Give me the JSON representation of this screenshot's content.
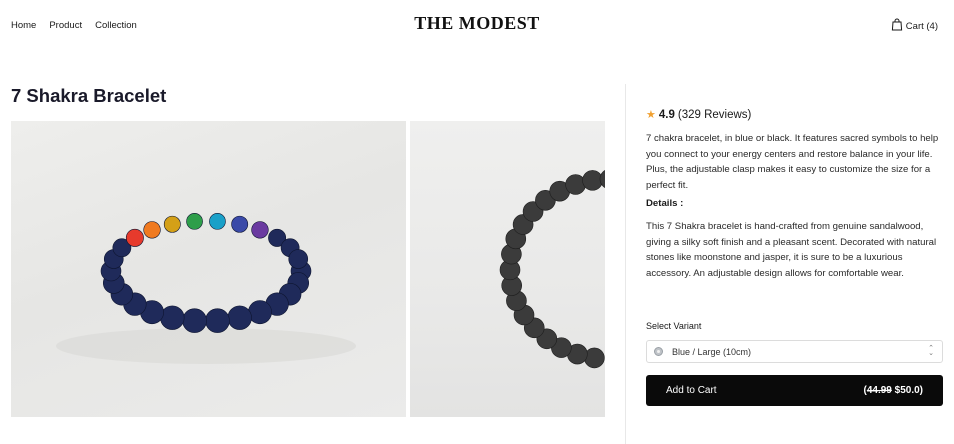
{
  "header": {
    "nav": [
      "Home",
      "Product",
      "Collection"
    ],
    "logo": "THE MODEST",
    "cart_label": "Cart (4)",
    "cart_icon": "shopping-bag-icon"
  },
  "product": {
    "title": "7 Shakra Bracelet",
    "images": [
      "bracelet-colorful-beads-photo",
      "bracelet-lava-stone-photo"
    ],
    "rating": {
      "icon": "star-icon",
      "star_color": "#f0a030",
      "score": "4.9",
      "reviews": "(329 Reviews)"
    },
    "description": "7 chakra bracelet, in blue or black. It features sacred symbols to help you connect to your energy centers and restore balance in your life. Plus, the adjustable clasp makes it easy to customize the size for a perfect fit.",
    "details_heading": "Details :",
    "details_text": "This 7 Shakra bracelet is hand-crafted from genuine sandalwood, giving a silky soft finish and a pleasant scent. Decorated with natural stones like moonstone and jasper, it is sure to be a luxurious accessory. An adjustable design allows for comfortable wear.",
    "variant": {
      "label": "Select Variant",
      "selected": "Blue / Large (10cm)"
    },
    "add_to_cart": {
      "label": "Add to Cart",
      "price_prefix": "(",
      "old_price": "44.99",
      "new_price": "$50.0)",
      "button_color": "#0a0a0a"
    }
  }
}
